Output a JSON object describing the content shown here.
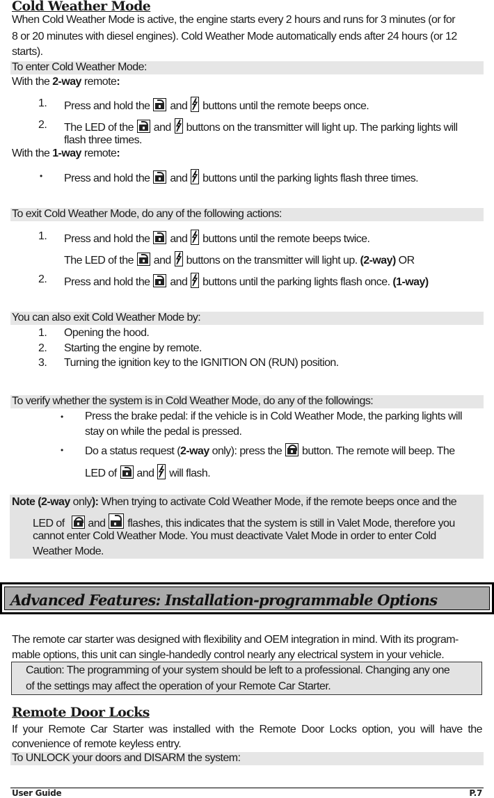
{
  "section1": {
    "heading": "Cold Weather Mode",
    "intro_line1": "When Cold Weather Mode is active, the engine starts every 2 hours and runs for 3 minutes (or for",
    "intro_line2a": "8 or 20 minutes with diesel engines)",
    "intro_line2b": ". Cold Weather Mode automatically ends after 24 hours (or 12",
    "intro_line3": "starts).",
    "enter_bar": "To enter Cold Weather Mode:",
    "two_way_prefix": "With the ",
    "two_way_bold": "2-way",
    "two_way_suffix": " remote",
    "colon": ":",
    "enter_2way_steps": [
      {
        "num": "1.",
        "a": "Press and hold the ",
        "b": " and ",
        "c": " buttons until the remote beeps once."
      },
      {
        "num": "2.",
        "a": "The LED of the ",
        "b": " and ",
        "c": " buttons on the transmitter will light up. The parking lights will",
        "d": "flash three times."
      }
    ],
    "one_way_prefix": "With the ",
    "one_way_bold": "1-way",
    "one_way_suffix": " remote",
    "enter_1way_steps": [
      {
        "bullet": "•",
        "a": "Press and hold the ",
        "b": " and ",
        "c": " buttons until the parking lights flash three times."
      }
    ],
    "exit_bar": "To exit Cold Weather Mode, do any of the following actions:",
    "exit_steps": [
      {
        "num": "1.",
        "a": "Press and hold the ",
        "b": " and ",
        "c": " buttons until the remote beeps twice."
      },
      {
        "num": "",
        "a": "The LED of the ",
        "b": " and ",
        "c": " buttons on the transmitter will light up. ",
        "bold": "(2-way)",
        "tail": " OR"
      },
      {
        "num": "2.",
        "a": "Press and hold the ",
        "b": " and ",
        "c": " buttons until the parking lights flash once. ",
        "bold": "(1-way)"
      }
    ],
    "also_exit_bar": "You can also exit Cold Weather Mode by:",
    "also_exit_steps": [
      {
        "num": "1.",
        "text": "Opening the hood."
      },
      {
        "num": "2.",
        "text": "Starting the engine by remote."
      },
      {
        "num": "3.",
        "text": "Turning the ignition key to the IGNITION ON (RUN) position."
      }
    ],
    "verify_bar": "To verify whether the system is in Cold Weather Mode, do any of the followings:",
    "verify_items": [
      {
        "bullet": "•",
        "line1": "Press the brake pedal: if the vehicle is in Cold Weather Mode, the parking lights will",
        "line2": "stay on while the pedal is pressed."
      },
      {
        "bullet": "•",
        "a": "Do a status request (",
        "bold": "2-way",
        "b": " only): press the ",
        "c": " button. The remote will beep. The",
        "d": "LED of ",
        "e": " and ",
        "f": " will flash."
      }
    ],
    "note": {
      "label_bold": "Note (2-way",
      "label_mid": " only",
      "label_end": "):",
      "line1": " When trying to activate Cold Weather Mode, if the remote beeps once and the",
      "line2a": "LED of ",
      "line2b": " and ",
      "line2c": "  flashes, this indicates that the system is still in Valet Mode, therefore you",
      "line3": "cannot enter Cold Weather Mode. You must deactivate Valet Mode in order to enter Cold",
      "line4": "Weather Mode."
    }
  },
  "banner": {
    "title": "Advanced Features: Installation-programmable Options"
  },
  "section2": {
    "intro_line1": "The remote car starter was designed with flexibility and OEM integration in mind. With its program-",
    "intro_line2": "mable options, this unit can single-handedly control nearly any electrical system in your vehicle.",
    "caution_line1": "Caution: The programming of your system should be left to a professional. Changing any one",
    "caution_line2": "of the settings may affect the operation of your Remote Car Starter."
  },
  "section3": {
    "heading": "Remote Door Locks",
    "line1": "If your Remote Car Starter was installed with the Remote Door Locks option, you will have the",
    "line2": "convenience of remote keyless entry.",
    "unlock_bar": "To UNLOCK your doors and DISARM the system:"
  },
  "footer": {
    "left": "User Guide",
    "right": "P.7"
  },
  "icons": {
    "lock_open": "unlock-button-icon",
    "lock_closed": "lock-button-icon",
    "bolt": "start-button-icon"
  }
}
